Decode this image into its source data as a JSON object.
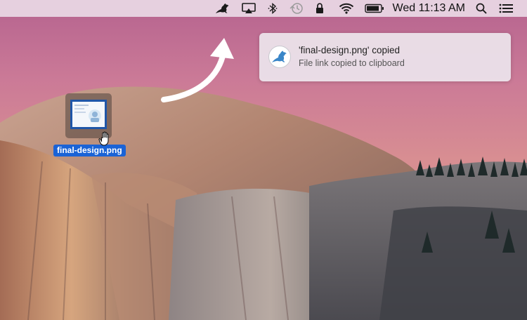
{
  "menubar": {
    "app_icon": "kangaroo-icon",
    "airplay_icon": "airplay-icon",
    "bluetooth_icon": "bluetooth-icon",
    "time_machine_icon": "time-machine-icon",
    "lock_icon": "lock-icon",
    "wifi_icon": "wifi-icon",
    "battery_icon": "battery-icon",
    "clock": "Wed 11:13 AM",
    "spotlight_icon": "search-icon",
    "notification_center_icon": "list-icon"
  },
  "notification": {
    "icon": "kangaroo-icon",
    "title": "'final-design.png' copied",
    "body": "File link copied to clipboard"
  },
  "desktop_file": {
    "name": "final-design.png",
    "selected": true
  },
  "colors": {
    "selection": "#1a63d6",
    "accent_arrow": "#ffffff",
    "app_icon_blue": "#3a86c8"
  }
}
